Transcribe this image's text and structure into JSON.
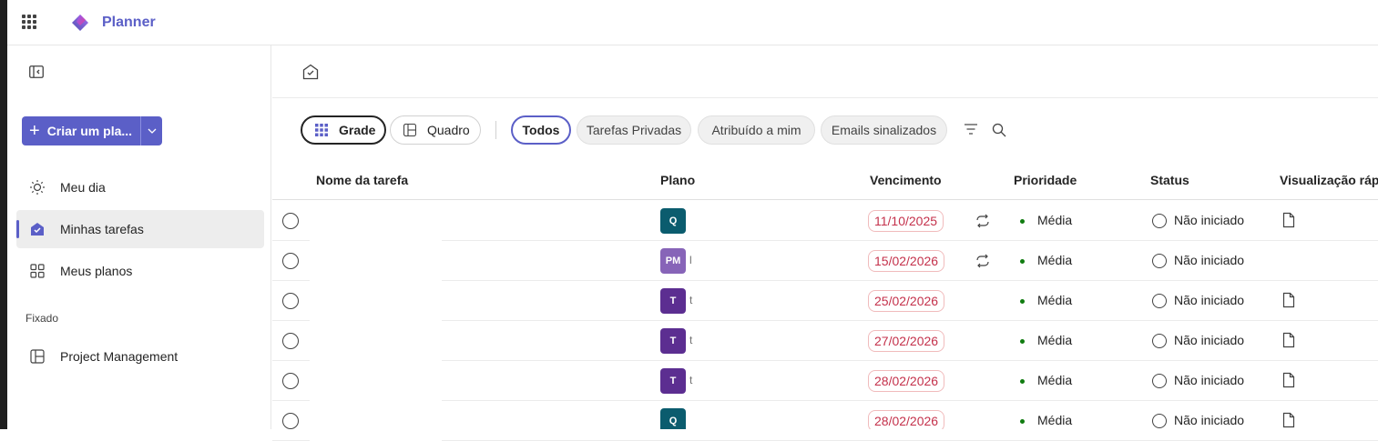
{
  "app": {
    "title": "Planner",
    "brand_color": "#5b5fc7"
  },
  "sidebar": {
    "create_label": "Criar um pla...",
    "items": [
      {
        "label": "Meu dia",
        "icon": "sun-icon",
        "active": false
      },
      {
        "label": "Minhas tarefas",
        "icon": "tasks-icon",
        "active": true
      },
      {
        "label": "Meus planos",
        "icon": "grid-icon",
        "active": false
      }
    ],
    "pinned_label": "Fixado",
    "pinned": [
      {
        "label": "Project Management",
        "icon": "board-icon"
      }
    ]
  },
  "toolbar": {
    "views": [
      {
        "label": "Grade",
        "selected": true
      },
      {
        "label": "Quadro",
        "selected": false
      }
    ],
    "filters": [
      {
        "label": "Todos",
        "selected": true
      },
      {
        "label": "Tarefas Privadas",
        "selected": false
      },
      {
        "label": "Atribuído a mim",
        "selected": false
      },
      {
        "label": "Emails sinalizados",
        "selected": false
      }
    ]
  },
  "grid": {
    "columns": [
      "Nome da tarefa",
      "Plano",
      "Vencimento",
      "Prioridade",
      "Status",
      "Visualização rápi"
    ],
    "rows": [
      {
        "plan_initials": "Q",
        "plan_color": "#0b5c6e",
        "plan_fragment": "",
        "due": "11/10/2025",
        "recurring": true,
        "priority": "Média",
        "status": "Não iniciado",
        "has_attachment": true
      },
      {
        "plan_initials": "PM",
        "plan_color": "#8764b8",
        "plan_fragment": "l",
        "due": "15/02/2026",
        "recurring": true,
        "priority": "Média",
        "status": "Não iniciado",
        "has_attachment": false
      },
      {
        "plan_initials": "T",
        "plan_color": "#5c2e91",
        "plan_fragment": "t",
        "due": "25/02/2026",
        "recurring": false,
        "priority": "Média",
        "status": "Não iniciado",
        "has_attachment": true
      },
      {
        "plan_initials": "T",
        "plan_color": "#5c2e91",
        "plan_fragment": "t",
        "due": "27/02/2026",
        "recurring": false,
        "priority": "Média",
        "status": "Não iniciado",
        "has_attachment": true
      },
      {
        "plan_initials": "T",
        "plan_color": "#5c2e91",
        "plan_fragment": "t",
        "due": "28/02/2026",
        "recurring": false,
        "priority": "Média",
        "status": "Não iniciado",
        "has_attachment": true
      },
      {
        "plan_initials": "Q",
        "plan_color": "#0b5c6e",
        "plan_fragment": "",
        "due": "28/02/2026",
        "recurring": false,
        "priority": "Média",
        "status": "Não iniciado",
        "has_attachment": true
      }
    ]
  }
}
